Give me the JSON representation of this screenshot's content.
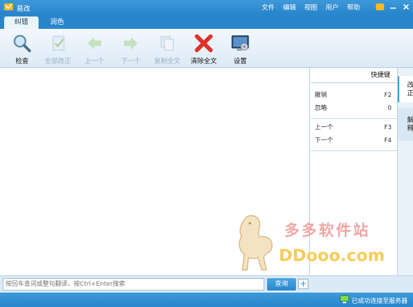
{
  "app": {
    "title": "易改"
  },
  "menu": [
    "文件",
    "编辑",
    "视图",
    "用户",
    "帮助"
  ],
  "tabs": [
    {
      "label": "纠错",
      "active": true
    },
    {
      "label": "润色",
      "active": false
    }
  ],
  "toolbar": {
    "check": "检查",
    "fix_all": "全部改正",
    "prev": "上一个",
    "next": "下一个",
    "copy_all": "复制全文",
    "clear_all": "清除全文",
    "settings": "设置"
  },
  "panel": {
    "title": "快捷键",
    "shortcuts_top": [
      {
        "label": "撤销",
        "key": "F2"
      },
      {
        "label": "忽略",
        "key": "0"
      }
    ],
    "shortcuts_bottom": [
      {
        "label": "上一个",
        "key": "F3"
      },
      {
        "label": "下一个",
        "key": "F4"
      }
    ]
  },
  "side_tabs": [
    {
      "label": "改正",
      "active": true
    },
    {
      "label": "解释",
      "active": false
    }
  ],
  "search": {
    "placeholder": "按回车查词或整句翻译，按Ctrl+Enter搜索",
    "button": "查询",
    "expand": "+"
  },
  "status": {
    "text": "已成功连接至服务器"
  },
  "watermark": {
    "cn": "多多软件站",
    "en": "DDooo.com"
  },
  "colors": {
    "accent": "#2a86cc",
    "toolbar_bg": "#dceaf6",
    "clear_red": "#e0322b"
  }
}
